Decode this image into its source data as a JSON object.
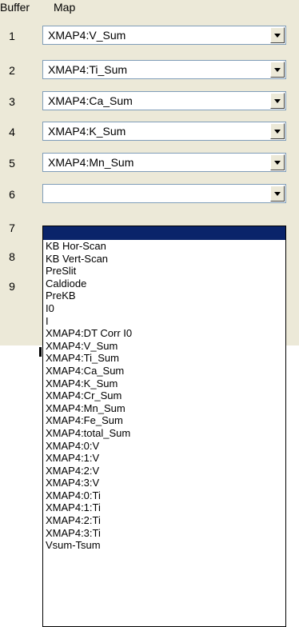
{
  "header": {
    "buffer_label": "Buffer",
    "map_label": "Map"
  },
  "rows": [
    {
      "number": "1",
      "value": "XMAP4:V_Sum"
    },
    {
      "number": "2",
      "value": "XMAP4:Ti_Sum"
    },
    {
      "number": "3",
      "value": "XMAP4:Ca_Sum"
    },
    {
      "number": "4",
      "value": "XMAP4:K_Sum"
    },
    {
      "number": "5",
      "value": "XMAP4:Mn_Sum"
    },
    {
      "number": "6",
      "value": ""
    }
  ],
  "hidden_rows": [
    "7",
    "8",
    "9"
  ],
  "dropdown": {
    "selected_index": 0,
    "options": [
      "",
      "KB Hor-Scan",
      "KB Vert-Scan",
      "PreSlit",
      "Caldiode",
      "PreKB",
      "I0",
      "I",
      "XMAP4:DT Corr I0",
      "XMAP4:V_Sum",
      "XMAP4:Ti_Sum",
      "XMAP4:Ca_Sum",
      "XMAP4:K_Sum",
      "XMAP4:Cr_Sum",
      "XMAP4:Mn_Sum",
      "XMAP4:Fe_Sum",
      "XMAP4:total_Sum",
      "XMAP4:0:V",
      "XMAP4:1:V",
      "XMAP4:2:V",
      "XMAP4:3:V",
      "XMAP4:0:Ti",
      "XMAP4:1:Ti",
      "XMAP4:2:Ti",
      "XMAP4:3:Ti",
      "Vsum-Tsum"
    ]
  },
  "colors": {
    "panel_bg": "#ece9d8",
    "selection_bg": "#0a246a",
    "field_border": "#7f9db9"
  }
}
